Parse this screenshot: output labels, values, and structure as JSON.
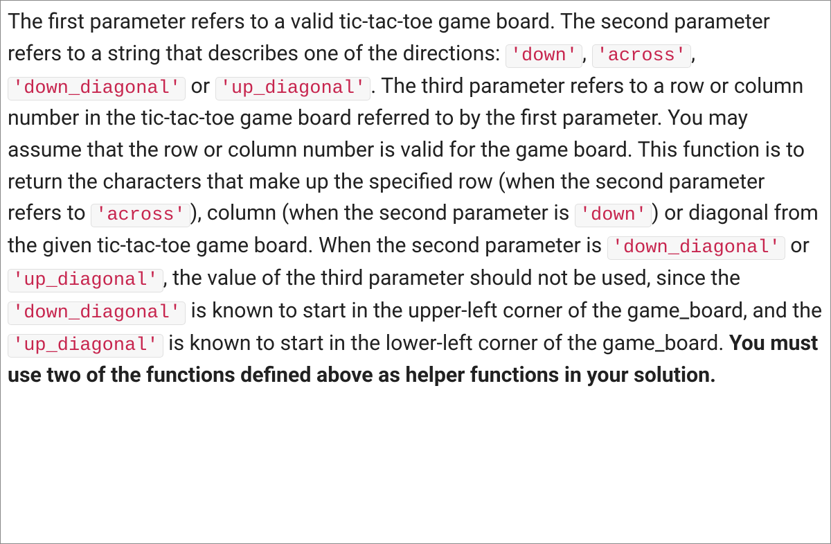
{
  "text": {
    "t1": "The first parameter refers to a valid tic-tac-toe game board. The second parameter refers to a string that describes one of the directions: ",
    "t2": ", ",
    "t3": ", ",
    "t4": " or ",
    "t5": ". The third parameter refers to a row or column number in the tic-tac-toe game board referred to by the first parameter. You may assume that the row or column number is valid for the game board. This function is to return the characters that make up the specified row (when the second parameter refers to ",
    "t6": "), column (when the second parameter is ",
    "t7": ") or diagonal from the given tic-tac-toe game board. When the second parameter is ",
    "t8": " or ",
    "t9": ", the value of the third parameter should not be used, since the ",
    "t10": " is known to start in the upper-left corner of the game_board, and the ",
    "t11": " is known to start in the lower-left corner of the game_board. ",
    "bold": "You must use two of the functions defined above as helper functions in your solution."
  },
  "codes": {
    "down1": "'down'",
    "across1": "'across'",
    "downdiag1": "'down_diagonal'",
    "updiag1": "'up_diagonal'",
    "across2": "'across'",
    "down2": "'down'",
    "downdiag2": "'down_diagonal'",
    "updiag2": "'up_diagonal'",
    "downdiag3": "'down_diagonal'",
    "updiag3": "'up_diagonal'"
  }
}
